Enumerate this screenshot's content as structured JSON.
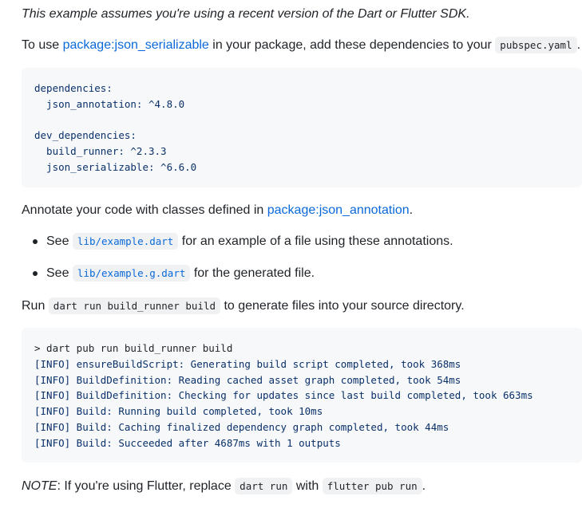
{
  "intro": {
    "text": "This example assumes you're using a recent version of the Dart or Flutter SDK."
  },
  "usage": {
    "prefix": "To use ",
    "package_link": "package:json_serializable",
    "middle": " in your package, add these dependencies to your ",
    "file_code": "pubspec.yaml",
    "suffix": "."
  },
  "dependencies_block": {
    "lines": [
      "dependencies:",
      "  json_annotation: ^4.8.0",
      "",
      "dev_dependencies:",
      "  build_runner: ^2.3.3",
      "  json_serializable: ^6.6.0"
    ]
  },
  "annotate": {
    "prefix": "Annotate your code with classes defined in ",
    "package_link": "package:json_annotation",
    "suffix": "."
  },
  "see_list": [
    {
      "prefix": "See ",
      "code": "lib/example.dart",
      "suffix": " for an example of a file using these annotations."
    },
    {
      "prefix": "See ",
      "code": "lib/example.g.dart",
      "suffix": " for the generated file."
    }
  ],
  "run": {
    "prefix": "Run ",
    "code": "dart run build_runner build",
    "suffix": " to generate files into your source directory."
  },
  "build_block": {
    "prompt": "> dart pub run build_runner build",
    "lines": [
      "[INFO] ensureBuildScript: Generating build script completed, took 368ms",
      "[INFO] BuildDefinition: Reading cached asset graph completed, took 54ms",
      "[INFO] BuildDefinition: Checking for updates since last build completed, took 663ms",
      "[INFO] Build: Running build completed, took 10ms",
      "[INFO] Build: Caching finalized dependency graph completed, took 44ms",
      "[INFO] Build: Succeeded after 4687ms with 1 outputs"
    ]
  },
  "note": {
    "label": "NOTE",
    "prefix": ": If you're using Flutter, replace ",
    "code1": "dart run",
    "middle": " with ",
    "code2": "flutter pub run",
    "suffix": "."
  }
}
